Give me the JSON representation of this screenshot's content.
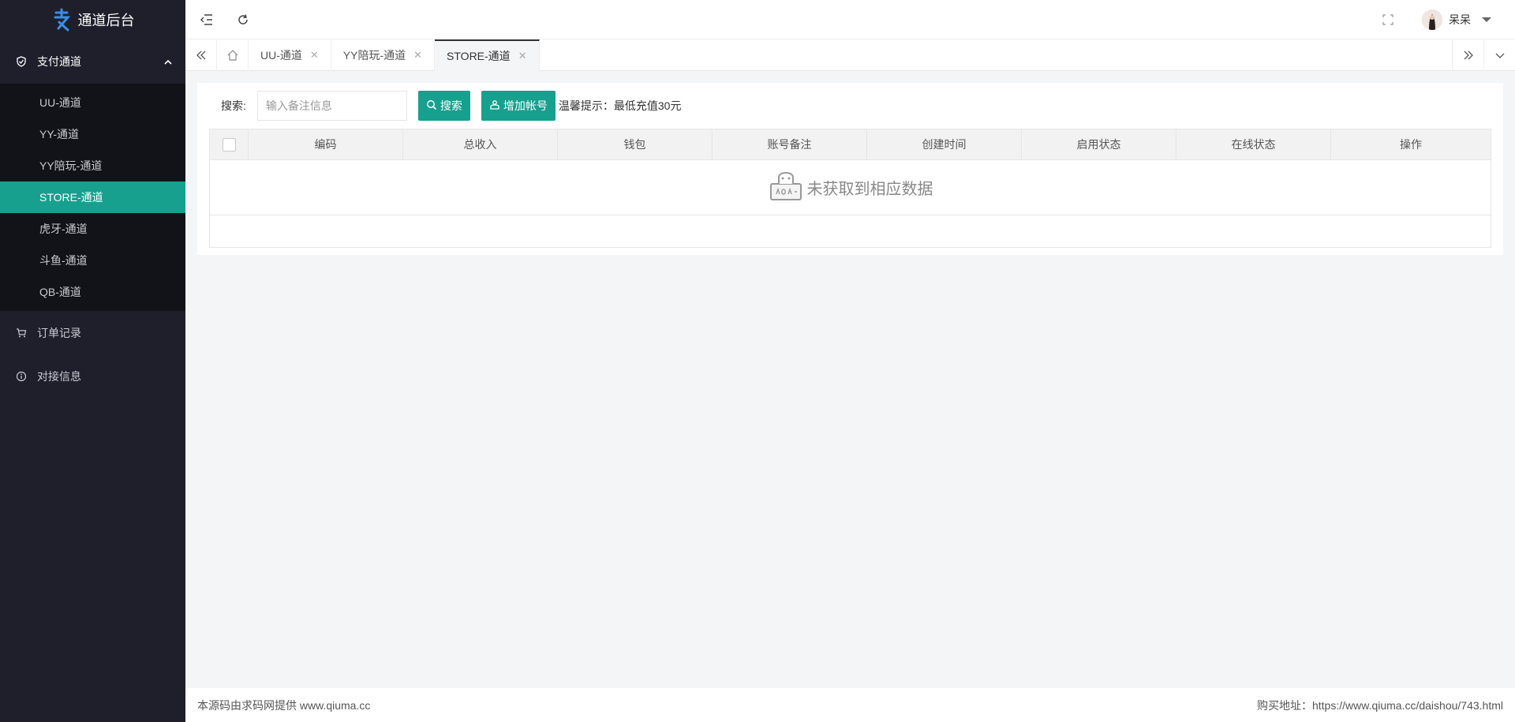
{
  "app": {
    "title": "通道后台"
  },
  "sidebar": {
    "group": {
      "label": "支付通道",
      "icon": "shield-check-icon"
    },
    "items": [
      {
        "label": "UU-通道"
      },
      {
        "label": "YY-通道"
      },
      {
        "label": "YY陪玩-通道"
      },
      {
        "label": "STORE-通道",
        "active": true
      },
      {
        "label": "虎牙-通道"
      },
      {
        "label": "斗鱼-通道"
      },
      {
        "label": "QB-通道"
      }
    ],
    "other": [
      {
        "label": "订单记录",
        "icon": "cart-icon"
      },
      {
        "label": "对接信息",
        "icon": "info-circle-icon"
      }
    ]
  },
  "header": {
    "user": {
      "name": "呆呆"
    }
  },
  "tabs": [
    {
      "label": "UU-通道"
    },
    {
      "label": "YY陪玩-通道"
    },
    {
      "label": "STORE-通道",
      "active": true
    }
  ],
  "toolbar": {
    "search_label": "搜索:",
    "search_placeholder": "输入备注信息",
    "search_button": "搜索",
    "add_button": "增加帐号",
    "tip": "温馨提示：最低充值30元"
  },
  "table": {
    "columns": [
      "编码",
      "总收入",
      "钱包",
      "账号备注",
      "创建时间",
      "启用状态",
      "在线状态",
      "操作"
    ],
    "rows": [],
    "empty_text": "未获取到相应数据"
  },
  "footer": {
    "left": "本源码由求码网提供 www.qiuma.cc",
    "right": "购买地址：https://www.qiuma.cc/daishou/743.html"
  },
  "colors": {
    "accent": "#16a08d",
    "sidebar_bg": "#1e1f2b",
    "submenu_bg": "#121318"
  }
}
